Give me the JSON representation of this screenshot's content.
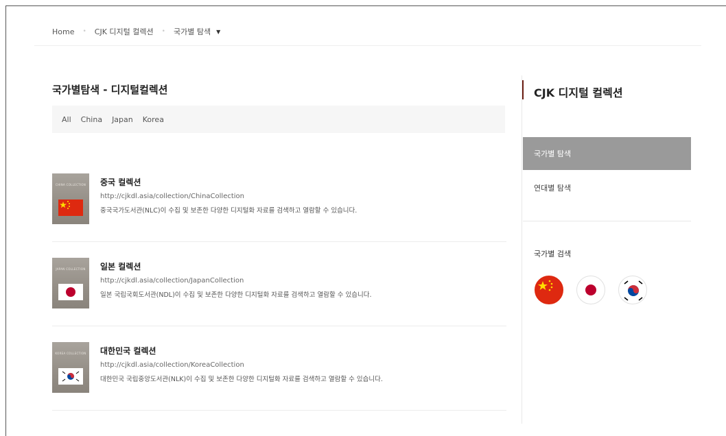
{
  "breadcrumb": {
    "home": "Home",
    "level1": "CJK 디지털 컬렉션",
    "level2": "국가별 탐색",
    "caret": "▼",
    "sep": "•"
  },
  "main": {
    "title": "국가별탐색 - 디지털컬렉션",
    "filters": [
      "All",
      "China",
      "Japan",
      "Korea"
    ],
    "items": [
      {
        "name": "중국 컬렉션",
        "url": "http://cjkdl.asia/collection/ChinaCollection",
        "description": "중국국가도서관(NLC)이 수집 및 보존한 다양한 디지털화 자료를 검색하고 열람할 수 있습니다.",
        "thumb_label": "CHINA COLLECTION"
      },
      {
        "name": "일본 컬렉션",
        "url": "http://cjkdl.asia/collection/JapanCollection",
        "description": "일본 국립국회도서관(NDL)이 수집 및 보존한 다양한 디지털화 자료를 검색하고 열람할 수 있습니다.",
        "thumb_label": "JAPAN COLLECTION"
      },
      {
        "name": "대한민국 컬렉션",
        "url": "http://cjkdl.asia/collection/KoreaCollection",
        "description": "대한민국 국립중앙도서관(NLK)이 수집 및 보존한 다양한 디지털화 자료를 검색하고 열람할 수 있습니다.",
        "thumb_label": "KOREA COLLECTION"
      }
    ]
  },
  "sidebar": {
    "title": "CJK 디지털 컬렉션",
    "menu": [
      "국가별 탐색",
      "연대별 탐색"
    ],
    "country_search_label": "국가별 검색",
    "flags": [
      "china-flag-icon",
      "japan-flag-icon",
      "korea-flag-icon"
    ]
  },
  "colors": {
    "accent": "#6b1d12",
    "active_menu_bg": "#9a9a9a",
    "china_red": "#de2910",
    "japan_red": "#bc002d"
  }
}
